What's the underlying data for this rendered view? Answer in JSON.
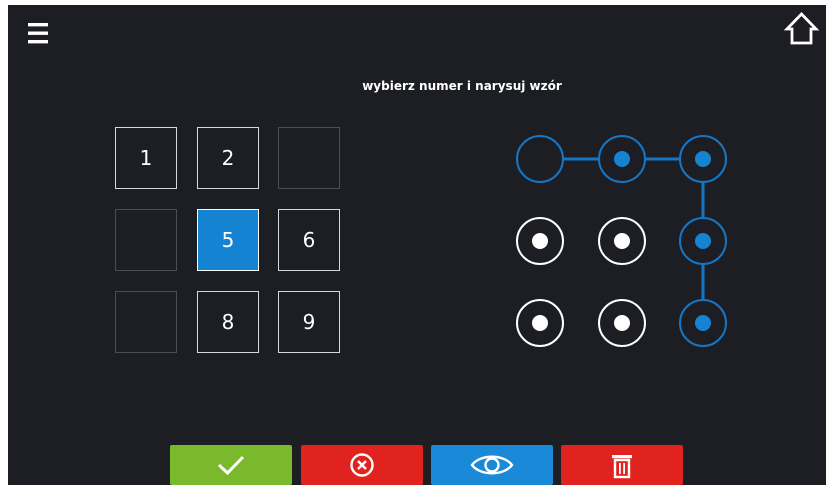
{
  "header": {
    "menu_icon": "hamburger-menu-icon",
    "home_icon": "home-icon"
  },
  "prompt": "wybierz numer i narysuj wzór",
  "keypad": {
    "keys": [
      {
        "label": "1",
        "state": "available"
      },
      {
        "label": "2",
        "state": "available"
      },
      {
        "label": "",
        "state": "empty"
      },
      {
        "label": "",
        "state": "empty"
      },
      {
        "label": "5",
        "state": "selected"
      },
      {
        "label": "6",
        "state": "available"
      },
      {
        "label": "",
        "state": "empty"
      },
      {
        "label": "8",
        "state": "available"
      },
      {
        "label": "9",
        "state": "available"
      }
    ]
  },
  "pattern": {
    "dots": [
      {
        "row": 1,
        "col": 1,
        "state": "path-start"
      },
      {
        "row": 1,
        "col": 2,
        "state": "selected"
      },
      {
        "row": 1,
        "col": 3,
        "state": "selected"
      },
      {
        "row": 2,
        "col": 1,
        "state": "idle"
      },
      {
        "row": 2,
        "col": 2,
        "state": "idle"
      },
      {
        "row": 2,
        "col": 3,
        "state": "selected"
      },
      {
        "row": 3,
        "col": 1,
        "state": "idle"
      },
      {
        "row": 3,
        "col": 2,
        "state": "idle"
      },
      {
        "row": 3,
        "col": 3,
        "state": "selected"
      }
    ],
    "path_order": [
      1,
      2,
      3,
      6,
      9
    ]
  },
  "actions": [
    {
      "name": "confirm-button",
      "icon": "checkmark-icon",
      "color": "#7ab82c"
    },
    {
      "name": "cancel-button",
      "icon": "circle-x-icon",
      "color": "#e0231e"
    },
    {
      "name": "show-pattern-button",
      "icon": "eye-icon",
      "color": "#1a8ad8"
    },
    {
      "name": "delete-button",
      "icon": "trash-icon",
      "color": "#e0231e"
    }
  ],
  "colors": {
    "background": "#1c1e24",
    "accent": "#1683d2",
    "pattern_line": "#1676c4",
    "idle_dot": "#ffffff"
  }
}
